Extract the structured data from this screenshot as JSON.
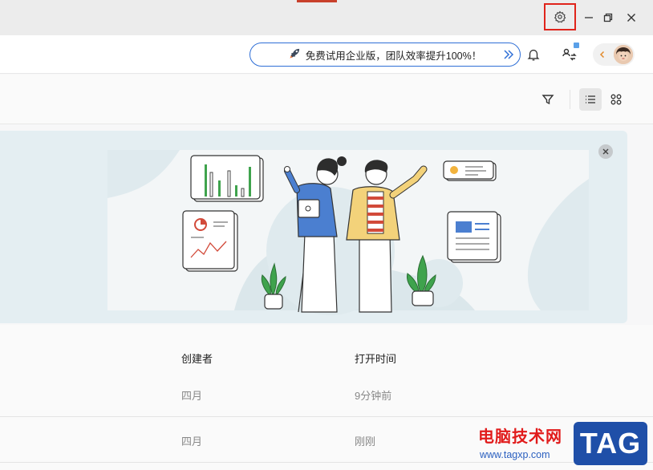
{
  "window": {
    "settings_icon": "gear-icon",
    "minimize_icon": "minimize-icon",
    "restore_icon": "restore-icon",
    "close_icon": "close-icon"
  },
  "header": {
    "promo_text": "免费试用企业版，团队效率提升100%！",
    "promo_icon": "rocket-icon",
    "promo_arrow_icon": "double-chevron-right-icon",
    "notification_icon": "bell-icon",
    "switch_icon": "switch-account-icon",
    "collapse_icon": "chevron-left-icon",
    "avatar_icon": "avatar"
  },
  "toolbar": {
    "filter_icon": "filter-icon",
    "list_view_icon": "list-view-icon",
    "grid_view_icon": "grid-view-icon",
    "active_view": "list"
  },
  "banner": {
    "close_icon": "close-icon"
  },
  "table": {
    "columns": [
      "创建者",
      "打开时间"
    ],
    "rows": [
      {
        "creator": "四月",
        "opened": "9分钟前"
      },
      {
        "creator": "四月",
        "opened": "刚刚"
      }
    ]
  },
  "watermark": {
    "site_name": "电脑技术网",
    "url": "www.tagxp.com",
    "tag": "TAG"
  },
  "colors": {
    "accent": "#2f6fd6",
    "highlight_box": "#e0241b",
    "banner_bg": "#e4eef2"
  }
}
